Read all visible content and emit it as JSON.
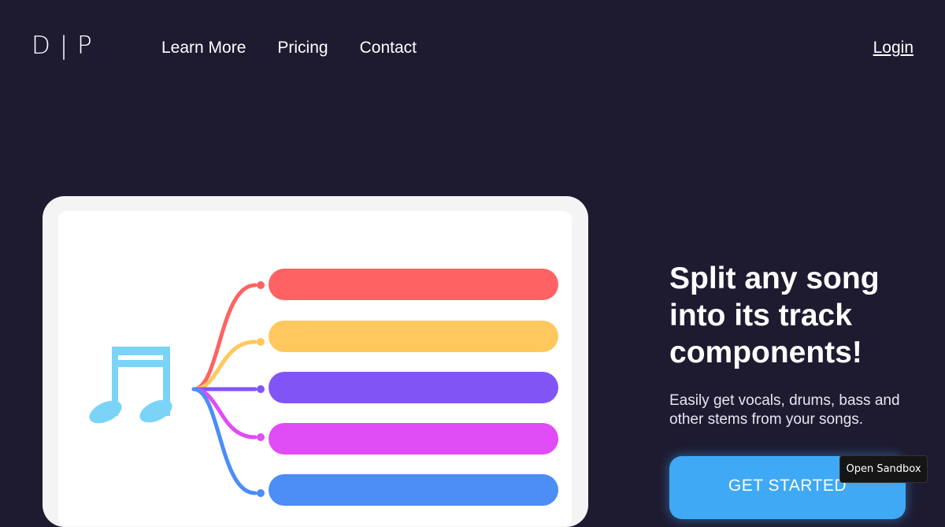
{
  "header": {
    "logo": "D | P",
    "nav": [
      "Learn More",
      "Pricing",
      "Contact"
    ],
    "login": "Login"
  },
  "hero": {
    "headline": "Split any song into its track components!",
    "subline": "Easily get vocals, drums, bass and other stems from your songs.",
    "cta": "GET STARTED"
  },
  "illustration": {
    "icon": "music-note-icon",
    "stem_colors": [
      "#ff6262",
      "#ffc85c",
      "#8155f5",
      "#e04cf5",
      "#4c8df6"
    ],
    "note_color": "#79d4f8"
  },
  "overlay": {
    "sandbox": "Open Sandbox"
  },
  "colors": {
    "background": "#1e1b31",
    "cta": "#3fa9f5"
  }
}
